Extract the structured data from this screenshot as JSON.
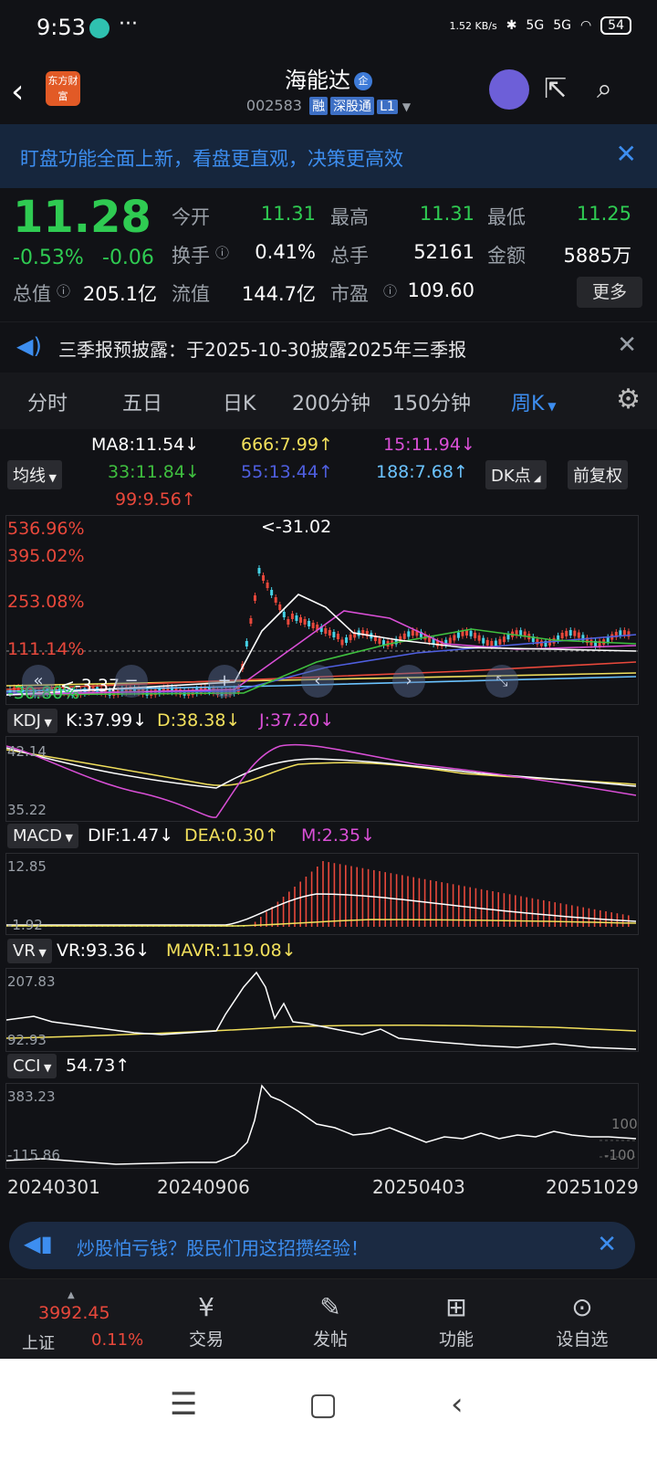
{
  "status": {
    "time": "9:53",
    "net_speed": "1.52 KB/s",
    "signal_a": "5G",
    "signal_b": "5G",
    "battery": "54"
  },
  "header": {
    "name": "海能达",
    "code": "002583",
    "tags": [
      "融",
      "深股通",
      "L1"
    ],
    "logo_text": "东方财富"
  },
  "banner": {
    "text": "盯盘功能全面上新，看盘更直观，决策更高效"
  },
  "quote": {
    "price": "11.28",
    "pct": "-0.53%",
    "chg": "-0.06",
    "open_l": "今开",
    "open": "11.31",
    "high_l": "最高",
    "high": "11.31",
    "low_l": "最低",
    "low": "11.25",
    "turn_l": "换手",
    "turn": "0.41%",
    "vol_l": "总手",
    "vol": "52161",
    "amt_l": "金额",
    "amt": "5885万",
    "cap_l": "总值",
    "cap": "205.1亿",
    "flt_l": "流值",
    "flt": "144.7亿",
    "pe_l": "市盈",
    "pe": "109.60",
    "more": "更多"
  },
  "notice": {
    "text": "三季报预披露：于2025-10-30披露2025年三季报"
  },
  "tabs": [
    "分时",
    "五日",
    "日K",
    "200分钟",
    "150分钟",
    "周K"
  ],
  "ma": {
    "switch": "均线",
    "ma8": "MA8:11.54↓",
    "ma666": "666:7.99↑",
    "ma15": "15:11.94↓",
    "ma33": "33:11.84↓",
    "ma55": "55:13.44↑",
    "ma188": "188:7.68↑",
    "ma99": "99:9.56↑",
    "dk": "DK点",
    "adj": "前复权"
  },
  "kline": {
    "y_labels": [
      "536.96%",
      "395.02%",
      "253.08%",
      "111.14%",
      "-30.80%"
    ],
    "peak": "<-31.02",
    "trough": "<-3.37",
    "colors": {
      "up": "#e8483b",
      "down": "#45d2e6",
      "ma8": "#ffffff",
      "ma15": "#d94fd6",
      "ma33": "#3fbf3f",
      "ma55": "#4f5fe0",
      "ma99": "#e8483b",
      "ma188": "#6bc3ff",
      "ma666": "#f2e05c"
    }
  },
  "kdj": {
    "name": "KDJ",
    "k": "K:37.99↓",
    "d": "D:38.38↓",
    "j": "J:37.20↓",
    "top": "42.14",
    "bottom": "35.22"
  },
  "macd": {
    "name": "MACD",
    "dif": "DIF:1.47↓",
    "dea": "DEA:0.30↑",
    "m": "M:2.35↓",
    "top": "12.85",
    "bottom": "-1.92"
  },
  "vr": {
    "name": "VR",
    "vr": "VR:93.36↓",
    "mavr": "MAVR:119.08↓",
    "top": "207.83",
    "bottom": "92.93"
  },
  "cci": {
    "name": "CCI",
    "cci": "54.73↑",
    "top": "383.23",
    "bottom": "-115.86",
    "r100": "100",
    "rm100": "-100"
  },
  "dates": [
    "20240301",
    "20240906",
    "20250403",
    "20251029"
  ],
  "ad": {
    "text": "炒股怕亏钱？股民们用这招攒经验！"
  },
  "bottom": {
    "index_name": "上证",
    "index_val": "3992.45",
    "index_pct": "0.11%",
    "items": [
      "交易",
      "发帖",
      "功能",
      "设自选"
    ]
  }
}
